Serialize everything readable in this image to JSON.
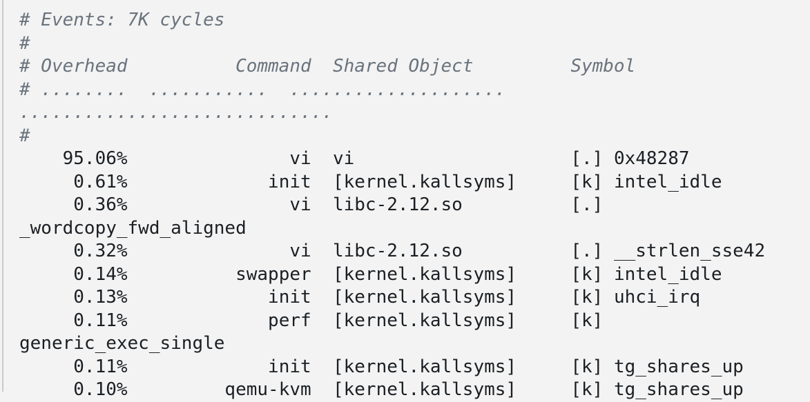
{
  "window": {
    "kind": "terminal-code-block",
    "background_color": "#f3f3f3",
    "left_rule_color": "#c9c9c9",
    "comment_color": "#6a737d",
    "text_color": "#1b1f23"
  },
  "report": {
    "tool": "perf report",
    "events_line": "# Events: 7K cycles",
    "blank_comment_1": "#",
    "header_line": "# Overhead          Command  Shared Object         Symbol",
    "separator_line": "# ........  ...........  ....................  .............................",
    "blank_comment_2": "#",
    "columns": [
      "Overhead",
      "Command",
      "Shared Object",
      "Symbol"
    ],
    "event_count": "7K",
    "event_type": "cycles"
  },
  "rows": [
    {
      "overhead": "95.06%",
      "command": "vi",
      "shared_object": "vi",
      "level": "[.]",
      "symbol": "0x48287",
      "line": "    95.06%               vi  vi                    [.] 0x48287"
    },
    {
      "overhead": "0.61%",
      "command": "init",
      "shared_object": "[kernel.kallsyms]",
      "level": "[k]",
      "symbol": "intel_idle",
      "line": "     0.61%             init  [kernel.kallsyms]     [k] intel_idle"
    },
    {
      "overhead": "0.36%",
      "command": "vi",
      "shared_object": "libc-2.12.so",
      "level": "[.]",
      "symbol": "_wordcopy_fwd_aligned",
      "line": "     0.36%               vi  libc-2.12.so          [.] _wordcopy_fwd_aligned"
    },
    {
      "overhead": "0.32%",
      "command": "vi",
      "shared_object": "libc-2.12.so",
      "level": "[.]",
      "symbol": "__strlen_sse42",
      "line": "     0.32%               vi  libc-2.12.so          [.] __strlen_sse42"
    },
    {
      "overhead": "0.14%",
      "command": "swapper",
      "shared_object": "[kernel.kallsyms]",
      "level": "[k]",
      "symbol": "intel_idle",
      "line": "     0.14%          swapper  [kernel.kallsyms]     [k] intel_idle"
    },
    {
      "overhead": "0.13%",
      "command": "init",
      "shared_object": "[kernel.kallsyms]",
      "level": "[k]",
      "symbol": "uhci_irq",
      "line": "     0.13%             init  [kernel.kallsyms]     [k] uhci_irq"
    },
    {
      "overhead": "0.11%",
      "command": "perf",
      "shared_object": "[kernel.kallsyms]",
      "level": "[k]",
      "symbol": "generic_exec_single",
      "line": "     0.11%             perf  [kernel.kallsyms]     [k] generic_exec_single"
    },
    {
      "overhead": "0.11%",
      "command": "init",
      "shared_object": "[kernel.kallsyms]",
      "level": "[k]",
      "symbol": "tg_shares_up",
      "line": "     0.11%             init  [kernel.kallsyms]     [k] tg_shares_up"
    },
    {
      "overhead": "0.10%",
      "command": "qemu-kvm",
      "shared_object": "[kernel.kallsyms]",
      "level": "[k]",
      "symbol": "tg_shares_up",
      "line": "     0.10%         qemu-kvm  [kernel.kallsyms]     [k] tg_shares_up"
    }
  ]
}
